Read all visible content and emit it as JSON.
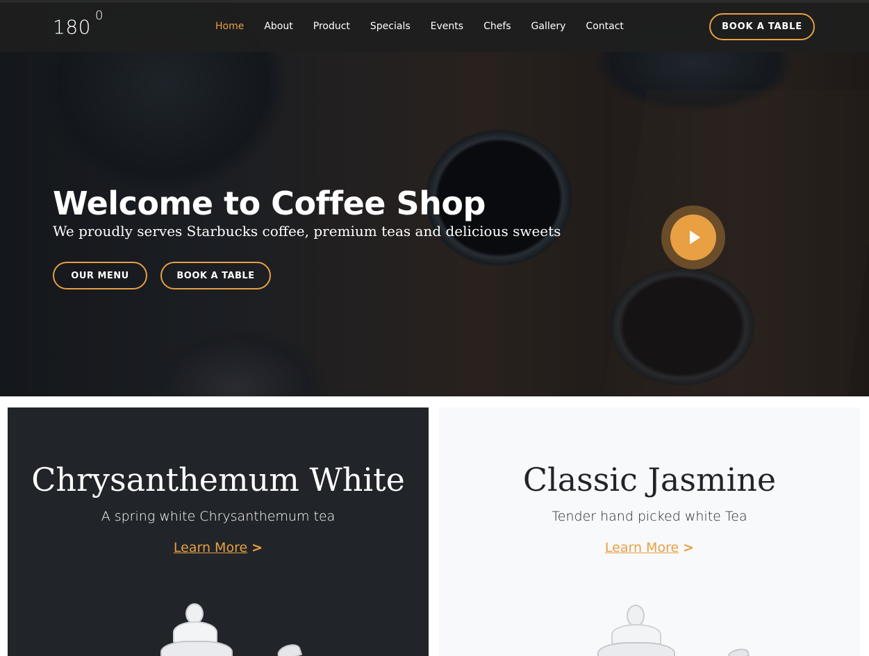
{
  "header": {
    "logo_text": "180",
    "logo_sup": "0",
    "nav": [
      {
        "label": "Home",
        "active": true
      },
      {
        "label": "About",
        "active": false
      },
      {
        "label": "Product",
        "active": false
      },
      {
        "label": "Specials",
        "active": false
      },
      {
        "label": "Events",
        "active": false
      },
      {
        "label": "Chefs",
        "active": false
      },
      {
        "label": "Gallery",
        "active": false
      },
      {
        "label": "Contact",
        "active": false
      }
    ],
    "cta_label": "BOOK A TABLE"
  },
  "hero": {
    "title": "Welcome to Coffee Shop",
    "subtitle": "We proudly serves Starbucks coffee, premium teas and delicious sweets",
    "menu_button": "OUR MENU",
    "book_button": "BOOK A TABLE"
  },
  "cards": [
    {
      "title": "Chrysanthemum White",
      "description": "A spring white Chrysanthemum tea",
      "link_label": "Learn More",
      "link_chevron": ">",
      "theme": "dark"
    },
    {
      "title": "Classic Jasmine",
      "description": "Tender hand picked white Tea",
      "link_label": "Learn More",
      "link_chevron": ">",
      "theme": "light"
    }
  ],
  "colors": {
    "accent": "#e8a043",
    "dark_card": "#212529",
    "light_card": "#f8f9fa"
  },
  "icons": {
    "play": "play-icon"
  }
}
